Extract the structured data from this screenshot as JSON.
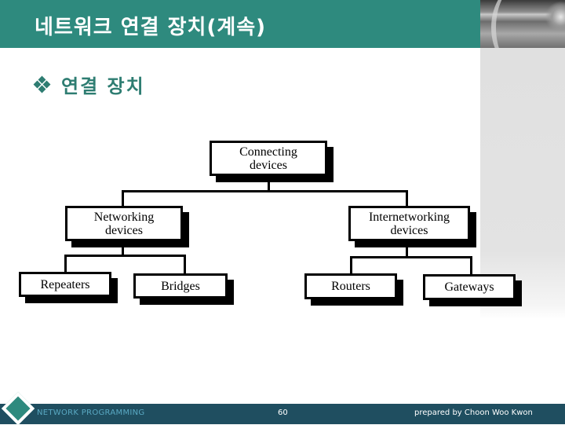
{
  "header": {
    "title": "네트워크 연결 장치(계속)"
  },
  "section": {
    "bullet_icon": "diamond-cluster-icon",
    "title": "연결 장치"
  },
  "diagram": {
    "root": "Connecting devices",
    "root_lines": [
      "Connecting",
      "devices"
    ],
    "level1": [
      {
        "label_lines": [
          "Networking",
          "devices"
        ],
        "children": [
          "Repeaters",
          "Bridges"
        ]
      },
      {
        "label_lines": [
          "Internetworking",
          "devices"
        ],
        "children": [
          "Routers",
          "Gateways"
        ]
      }
    ]
  },
  "footer": {
    "course": "NETWORK PROGRAMMING",
    "page_number": "60",
    "author": "prepared by Choon Woo Kwon"
  },
  "colors": {
    "header_bg": "#2e8a7e",
    "accent_text": "#2e7d72",
    "footer_bg": "#1f4e60",
    "footer_course_text": "#5aa9c3"
  }
}
